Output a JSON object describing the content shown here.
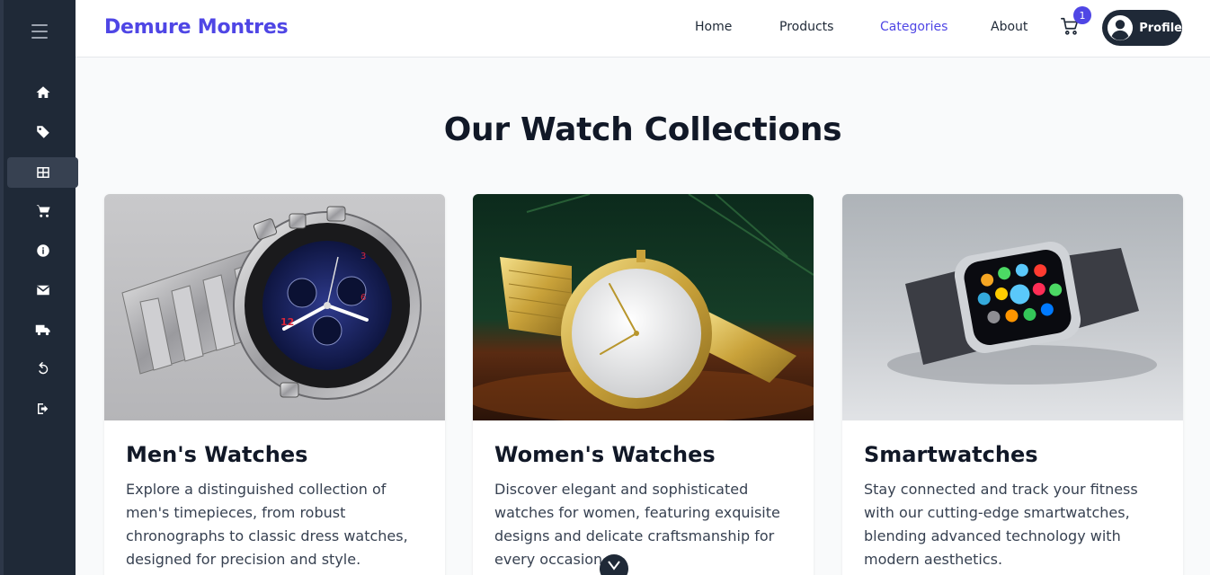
{
  "brand": "Demure Montres",
  "nav": {
    "home": "Home",
    "products": "Products",
    "categories": "Categories",
    "about": "About"
  },
  "cart": {
    "count": "1",
    "icon": "cart-icon"
  },
  "profile": {
    "label": "Profile",
    "icon": "user-avatar-icon"
  },
  "sidebar": {
    "items": [
      {
        "icon": "home-icon"
      },
      {
        "icon": "tag-icon"
      },
      {
        "icon": "grid-icon",
        "active": true
      },
      {
        "icon": "cart-icon"
      },
      {
        "icon": "info-icon"
      },
      {
        "icon": "envelope-icon"
      },
      {
        "icon": "truck-icon"
      },
      {
        "icon": "undo-icon"
      },
      {
        "icon": "sign-out-icon"
      }
    ]
  },
  "page": {
    "title": "Our Watch Collections"
  },
  "collections": [
    {
      "title": "Men's Watches",
      "description": "Explore a distinguished collection of men's timepieces, from robust chronographs to classic dress watches, designed for precision and style."
    },
    {
      "title": "Women's Watches",
      "description": "Discover elegant and sophisticated watches for women, featuring exquisite designs and delicate craftsmanship for every occasion."
    },
    {
      "title": "Smartwatches",
      "description": "Stay connected and track your fitness with our cutting-edge smartwatches, blending advanced technology with modern aesthetics."
    }
  ],
  "colors": {
    "accent": "#4f46e5",
    "sidebar": "#1f2937"
  }
}
